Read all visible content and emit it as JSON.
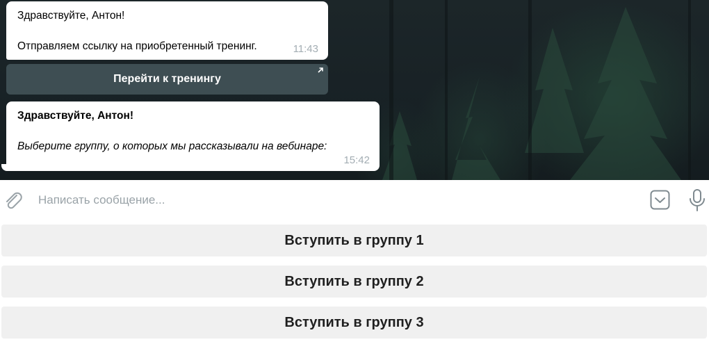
{
  "messages": [
    {
      "greeting": "Здравствуйте, Антон!",
      "body": "Отправляем ссылку на приобретенный тренинг.",
      "time": "11:43",
      "inline_button": {
        "label": "Перейти к тренингу",
        "icon": "external-link-arrow-icon"
      }
    },
    {
      "greeting": "Здравствуйте, Антон!",
      "body": "Выберите группу, о которых мы рассказывали на вебинаре:",
      "time": "15:42"
    }
  ],
  "composer": {
    "placeholder": "Написать сообщение...",
    "attach_icon": "paperclip-icon",
    "keyboard_icon": "chevron-down-icon",
    "mic_icon": "microphone-icon"
  },
  "reply_keyboard": [
    {
      "label": "Вступить в группу 1"
    },
    {
      "label": "Вступить в группу 2"
    },
    {
      "label": "Вступить в группу 3"
    }
  ],
  "colors": {
    "chat_background": "#1c2629",
    "bubble": "#ffffff",
    "timestamp": "#a3adb3",
    "inline_button": "#5c7378",
    "keyboard_button": "#f0f0f0"
  }
}
